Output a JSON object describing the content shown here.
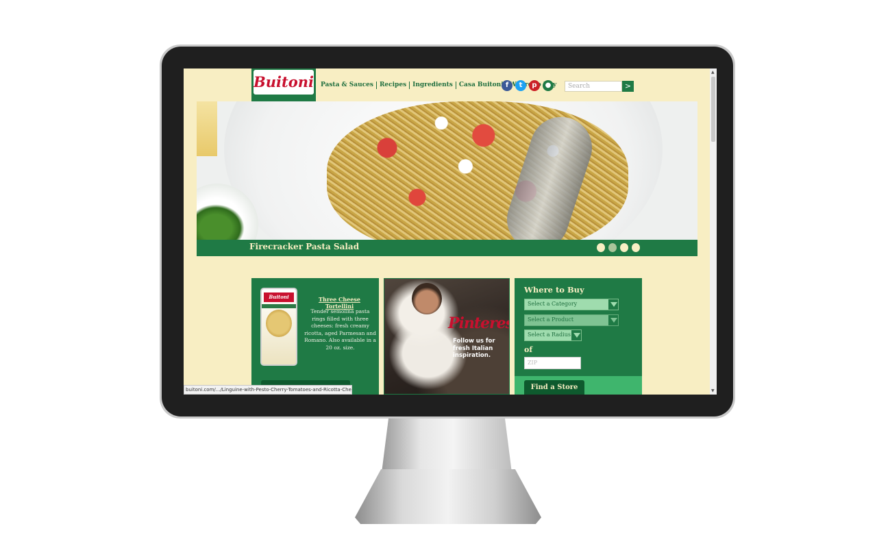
{
  "header": {
    "logo": "Buitoni",
    "nav": [
      "Pasta & Sauces",
      "Recipes",
      "Ingredients",
      "Casa Buitoni",
      "Where to Buy"
    ],
    "social": [
      {
        "name": "facebook",
        "glyph": "f",
        "color": "#3b5998"
      },
      {
        "name": "twitter",
        "glyph": "t",
        "color": "#1da1f2"
      },
      {
        "name": "pinterest",
        "glyph": "p",
        "color": "#cb2027"
      },
      {
        "name": "chat",
        "glyph": "●",
        "color": "#1f7a45"
      }
    ],
    "search_placeholder": "Search",
    "search_button": ">"
  },
  "hero": {
    "title": "Firecracker Pasta Salad",
    "slides": 4,
    "active_slide": 2
  },
  "product": {
    "package_label": "Buitoni",
    "name": "Three Cheese Tortellini",
    "description": "Tender semolina pasta rings filled with three cheeses: fresh creamy ricotta, aged Parmesan and Romano. Also available in a 20 oz. size."
  },
  "pinterest": {
    "logo": "Pinterest",
    "text": "Follow us for fresh Italian inspiration."
  },
  "where_to_buy": {
    "title": "Where to Buy",
    "category": "Select a Category",
    "product": "Select a Product",
    "radius": "Select a Radius",
    "of": "of",
    "zip_placeholder": "ZIP",
    "find_button": "Find a Store"
  },
  "status_bar": "buitoni.com/.../Linguine-with-Pesto-Cherry-Tomatoes-and-Ricotta-Cheese.aspx",
  "colors": {
    "brand_green": "#1f7a45",
    "brand_red": "#c8102e",
    "cream": "#f8eec3"
  }
}
